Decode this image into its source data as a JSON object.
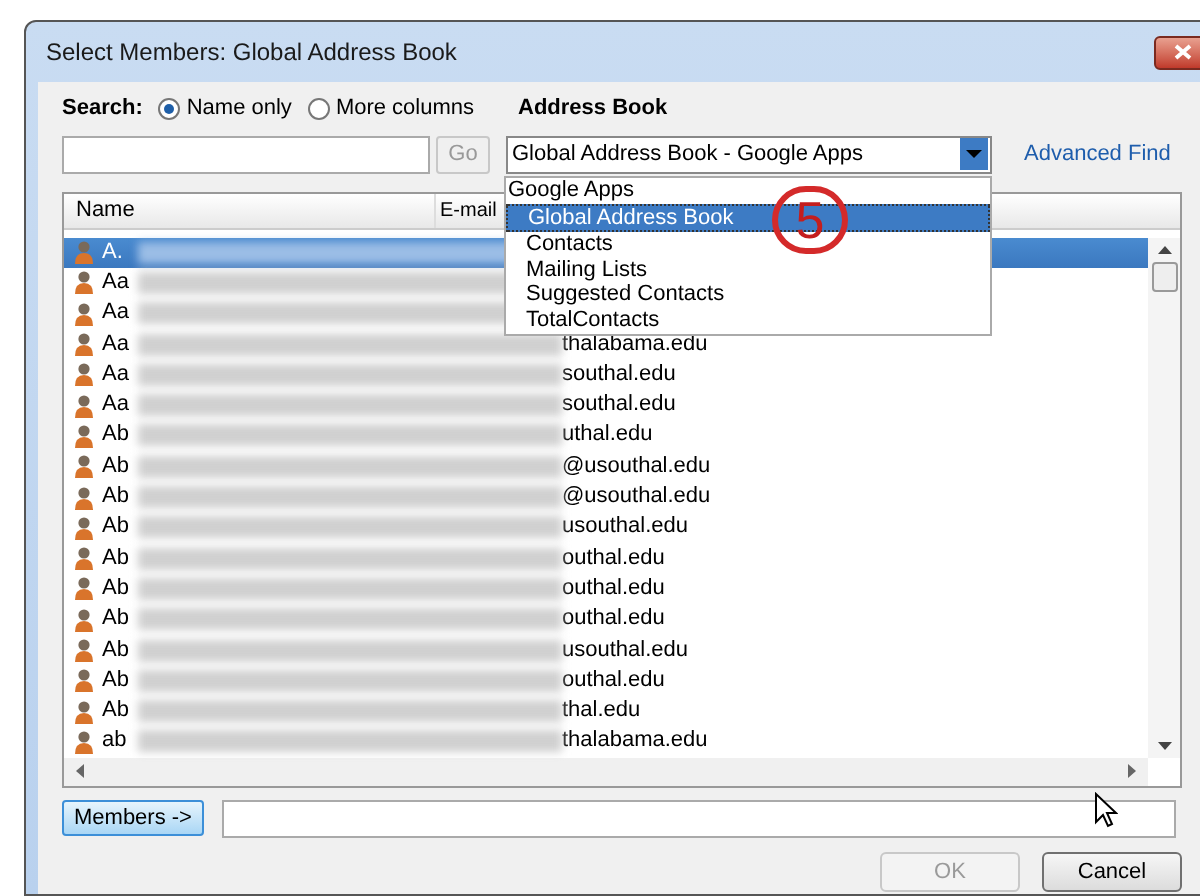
{
  "window": {
    "title": "Select Members: Global Address Book"
  },
  "search": {
    "label": "Search:",
    "options": [
      {
        "label": "Name only",
        "selected": true
      },
      {
        "label": "More columns",
        "selected": false
      }
    ],
    "go_button": "Go",
    "go_disabled": true
  },
  "address_book": {
    "label": "Address Book",
    "value": "Global Address Book - Google Apps",
    "advanced_find": "Advanced Find",
    "dropdown": {
      "group": "Google Apps",
      "items": [
        {
          "label": "Global Address Book",
          "selected": true
        },
        {
          "label": "Contacts",
          "selected": false
        },
        {
          "label": "Mailing Lists",
          "selected": false
        },
        {
          "label": "Suggested Contacts",
          "selected": false
        },
        {
          "label": "TotalContacts",
          "selected": false
        }
      ]
    }
  },
  "annotation": "5",
  "table": {
    "columns": [
      "Name",
      "E-mail"
    ],
    "rows": [
      {
        "name": "A.",
        "selected": true
      },
      {
        "name": "Aa",
        "selected": false
      },
      {
        "name": "Aa",
        "selected": false
      },
      {
        "name": "Aa",
        "email": "thalabama.edu",
        "selected": false
      },
      {
        "name": "Aa",
        "email": "southal.edu",
        "selected": false
      },
      {
        "name": "Aa",
        "email": "southal.edu",
        "selected": false
      },
      {
        "name": "Ab",
        "email": "uthal.edu",
        "selected": false
      },
      {
        "name": "Ab",
        "email": "@usouthal.edu",
        "selected": false
      },
      {
        "name": "Ab",
        "email": "@usouthal.edu",
        "selected": false
      },
      {
        "name": "Ab",
        "email": "usouthal.edu",
        "selected": false
      },
      {
        "name": "Ab",
        "email": "outhal.edu",
        "selected": false
      },
      {
        "name": "Ab",
        "email": "outhal.edu",
        "selected": false
      },
      {
        "name": "Ab",
        "email": "outhal.edu",
        "selected": false
      },
      {
        "name": "Ab",
        "email": "usouthal.edu",
        "selected": false
      },
      {
        "name": "Ab",
        "email": "outhal.edu",
        "selected": false
      },
      {
        "name": "Ab",
        "email": "thal.edu",
        "selected": false
      },
      {
        "name": "ab",
        "email": "thalabama.edu",
        "selected": false
      }
    ]
  },
  "members_button": "Members ->",
  "buttons": [
    {
      "label": "OK",
      "disabled": true
    },
    {
      "label": "Cancel",
      "disabled": false
    }
  ]
}
